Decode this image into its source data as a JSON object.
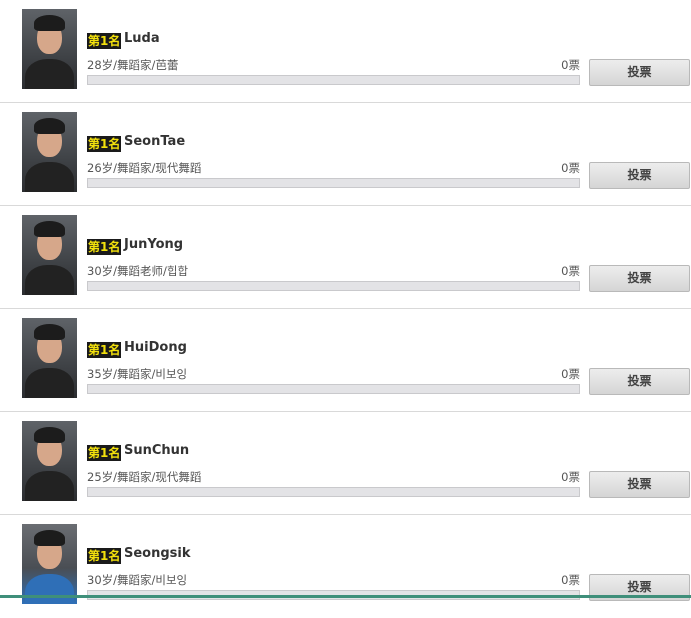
{
  "vote_label": "投票",
  "colors": {
    "rank_bg": "#1a1a1a",
    "rank_text": "#f3e10c",
    "bar_bg": "#e3e3e6"
  },
  "contestants": [
    {
      "rank": "第1名",
      "name": "Luda",
      "info": "28岁/舞蹈家/芭蕾",
      "votes": "0票",
      "progress": 0
    },
    {
      "rank": "第1名",
      "name": "SeonTae",
      "info": "26岁/舞蹈家/现代舞蹈",
      "votes": "0票",
      "progress": 0
    },
    {
      "rank": "第1名",
      "name": "JunYong",
      "info": "30岁/舞蹈老师/힙합",
      "votes": "0票",
      "progress": 0
    },
    {
      "rank": "第1名",
      "name": "HuiDong",
      "info": "35岁/舞蹈家/비보잉",
      "votes": "0票",
      "progress": 0
    },
    {
      "rank": "第1名",
      "name": "SunChun",
      "info": "25岁/舞蹈家/现代舞蹈",
      "votes": "0票",
      "progress": 0
    },
    {
      "rank": "第1名",
      "name": "Seongsik",
      "info": "30岁/舞蹈家/비보잉",
      "votes": "0票",
      "progress": 0
    }
  ]
}
